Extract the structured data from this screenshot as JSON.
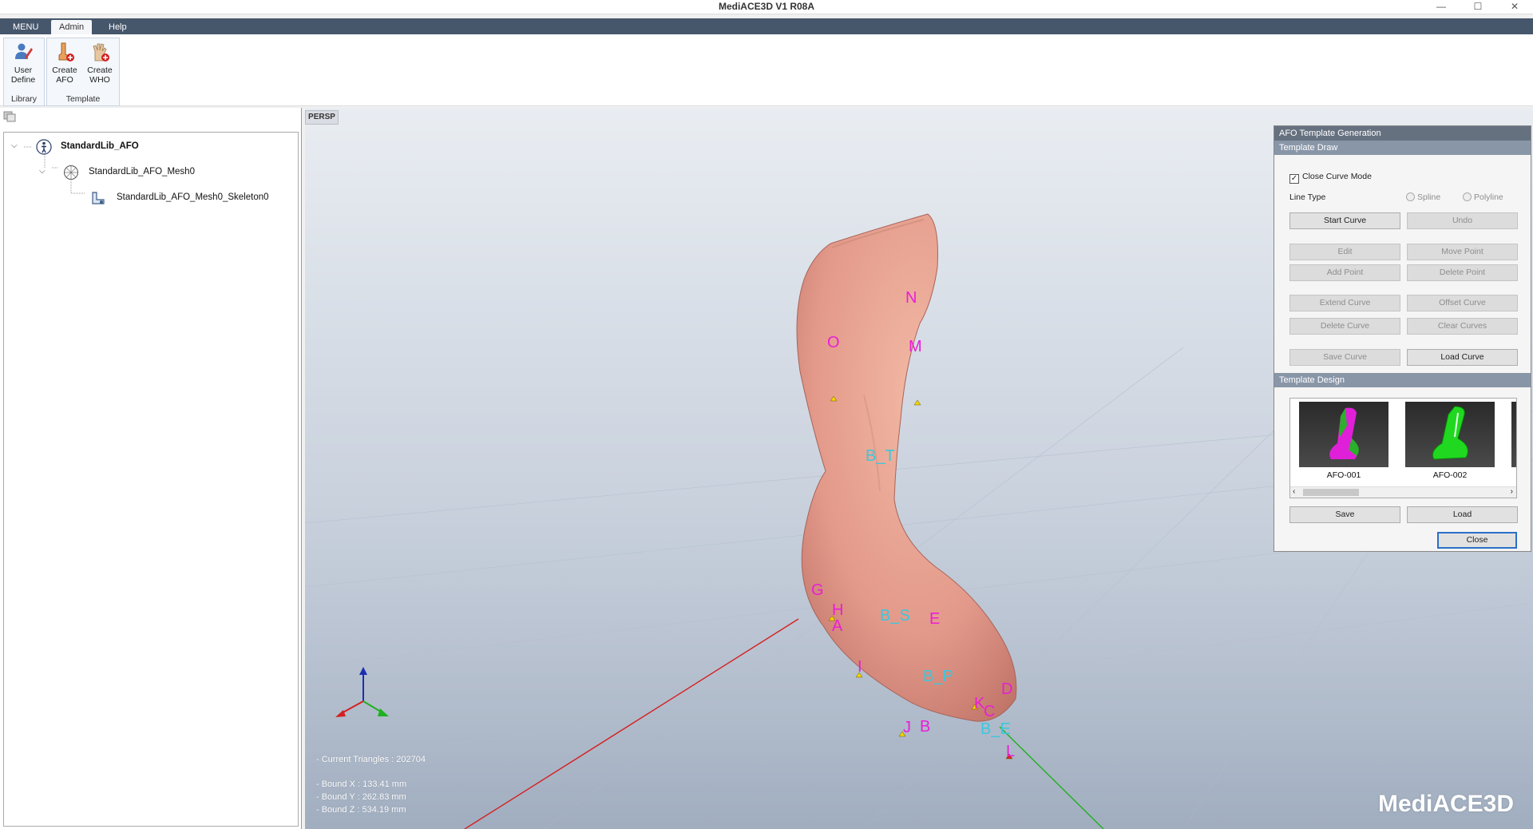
{
  "window": {
    "title": "MediACE3D V1 R08A",
    "controls": [
      "—",
      "☐",
      "✕"
    ]
  },
  "menubar": {
    "tabs": [
      {
        "label": "MENU"
      },
      {
        "label": "Admin"
      },
      {
        "label": "Help"
      }
    ]
  },
  "ribbon": {
    "library_group": {
      "label": "Library",
      "user_define_line1": "User",
      "user_define_line2": "Define"
    },
    "template_group": {
      "label": "Template",
      "create_afo_line1": "Create",
      "create_afo_line2": "AFO",
      "create_who_line1": "Create",
      "create_who_line2": "WHO"
    }
  },
  "tree": {
    "root": "StandardLib_AFO",
    "mesh": "StandardLib_AFO_Mesh0",
    "skeleton": "StandardLib_AFO_Mesh0_Skeleton0"
  },
  "viewport": {
    "tab": "PERSP",
    "info_triangles": "- Current Triangles : 202704",
    "info_bound_x": "- Bound X : 133.41 mm",
    "info_bound_y": "- Bound Y : 262.83 mm",
    "info_bound_z": "- Bound Z : 534.19 mm",
    "logo": "MediACE3D",
    "landmarks": [
      {
        "label": "N",
        "color": "#e81fd8"
      },
      {
        "label": "O",
        "color": "#e81fd8"
      },
      {
        "label": "M",
        "color": "#e81fd8"
      },
      {
        "label": "B_T",
        "color": "#3bc7dd"
      },
      {
        "label": "G",
        "color": "#e81fd8"
      },
      {
        "label": "H",
        "color": "#e81fd8"
      },
      {
        "label": "A",
        "color": "#e81fd8"
      },
      {
        "label": "B_S",
        "color": "#3bc7dd"
      },
      {
        "label": "E",
        "color": "#e81fd8"
      },
      {
        "label": "I",
        "color": "#e81fd8"
      },
      {
        "label": "B_P",
        "color": "#3bc7dd"
      },
      {
        "label": "D",
        "color": "#e81fd8"
      },
      {
        "label": "K",
        "color": "#e81fd8"
      },
      {
        "label": "C",
        "color": "#e81fd8"
      },
      {
        "label": "B_E",
        "color": "#3bc7dd"
      },
      {
        "label": "J",
        "color": "#e81fd8"
      },
      {
        "label": "B",
        "color": "#e81fd8"
      },
      {
        "label": "L",
        "color": "#e81fd8"
      }
    ]
  },
  "panel": {
    "title": "AFO Template Generation",
    "draw_section": "Template Draw",
    "close_curve_mode": "Close Curve Mode",
    "line_type_label": "Line Type",
    "spline": "Spline",
    "polyline": "Polyline",
    "start_curve": "Start Curve",
    "undo": "Undo",
    "edit": "Edit",
    "move_point": "Move Point",
    "add_point": "Add Point",
    "delete_point": "Delete Point",
    "extend_curve": "Extend Curve",
    "offset_curve": "Offset Curve",
    "delete_curve": "Delete Curve",
    "clear_curves": "Clear Curves",
    "save_curve": "Save Curve",
    "load_curve": "Load Curve",
    "design_section": "Template Design",
    "thumb1": "AFO-001",
    "thumb2": "AFO-002",
    "save": "Save",
    "load": "Load",
    "close": "Close"
  },
  "colors": {
    "menubar": "#46566b",
    "skin": "#e8a08a",
    "axis_x": "#d42020",
    "axis_y": "#20b020",
    "axis_z": "#1a2fb0"
  }
}
